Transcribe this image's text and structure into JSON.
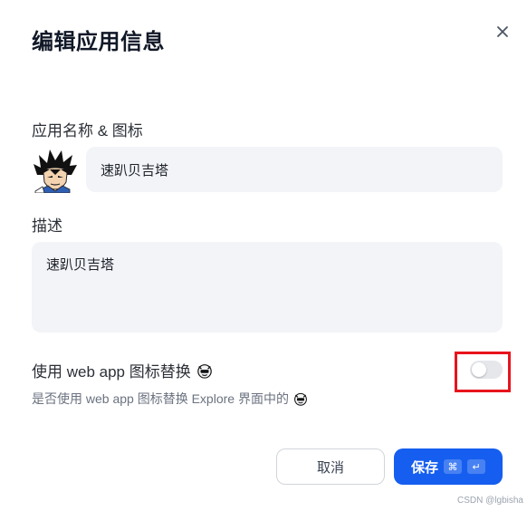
{
  "dialog": {
    "title": "编辑应用信息",
    "close_icon": "close-icon"
  },
  "name_section": {
    "label": "应用名称 & 图标",
    "avatar_icon": "vegeta-avatar-icon",
    "value": "速趴贝吉塔"
  },
  "description_section": {
    "label": "描述",
    "value": "速趴贝吉塔"
  },
  "webapp_icon_section": {
    "label": "使用 web app 图标替换",
    "hint": "是否使用 web app 图标替换 Explore 界面中的",
    "toggle_on": false,
    "highlight_color": "#e8141c"
  },
  "footer": {
    "cancel_label": "取消",
    "save_label": "保存",
    "save_shortcut_cmd": "⌘",
    "save_shortcut_enter": "↵",
    "accent": "#155eef"
  },
  "watermark": "CSDN @lgbisha"
}
